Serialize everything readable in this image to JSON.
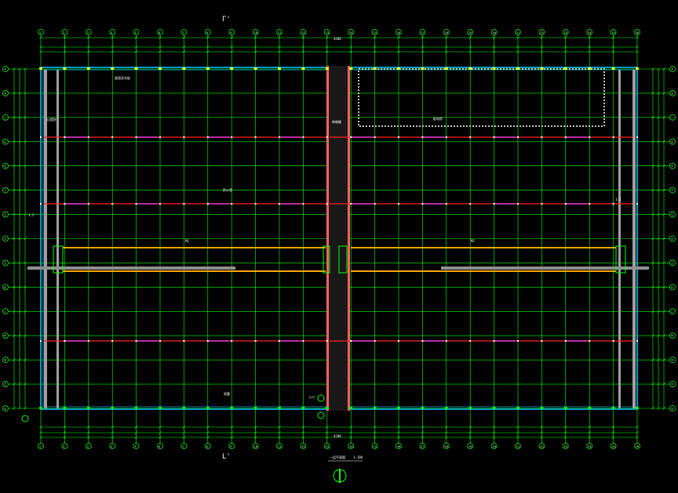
{
  "drawing": {
    "axis_top_labels": [
      "1",
      "2",
      "3",
      "4",
      "5",
      "6",
      "7",
      "8",
      "9",
      "10",
      "11",
      "12",
      "13",
      "14",
      "15",
      "16",
      "17",
      "18",
      "19",
      "20",
      "21",
      "22",
      "23",
      "24",
      "25",
      "26"
    ],
    "axis_side_labels": [
      "A",
      "B",
      "C",
      "D",
      "E",
      "F",
      "G",
      "H",
      "J",
      "K",
      "L",
      "M",
      "N",
      "P",
      "Q"
    ],
    "section_mark_top": "Γ'",
    "section_mark_bottom": "L'",
    "title_text": "一层平面图",
    "scale_text": "1:100",
    "dim_top_total": "4200",
    "dim_bottom_total": "4200",
    "note_left_col": "山墙柱",
    "note_mid_col": "伸缩缝",
    "note_room": "配电房",
    "note_upper": "屋面采光板",
    "note_center": "防火墙",
    "note_lower": "雨篷",
    "note_door_left": "M1",
    "note_door_right": "M2",
    "note_entry": "入口",
    "note_side_left": "1:2",
    "note_side_right": "1:2",
    "north_label": "N",
    "colors": {
      "grid": "#00ff00",
      "frame": "#00c8ff",
      "wall": "#c0c0c0",
      "beam_red": "#ff2020",
      "beam_magenta": "#ff40ff",
      "beam_orange": "#ffa500",
      "text": "#ffffff",
      "dim": "#00ff00"
    }
  }
}
